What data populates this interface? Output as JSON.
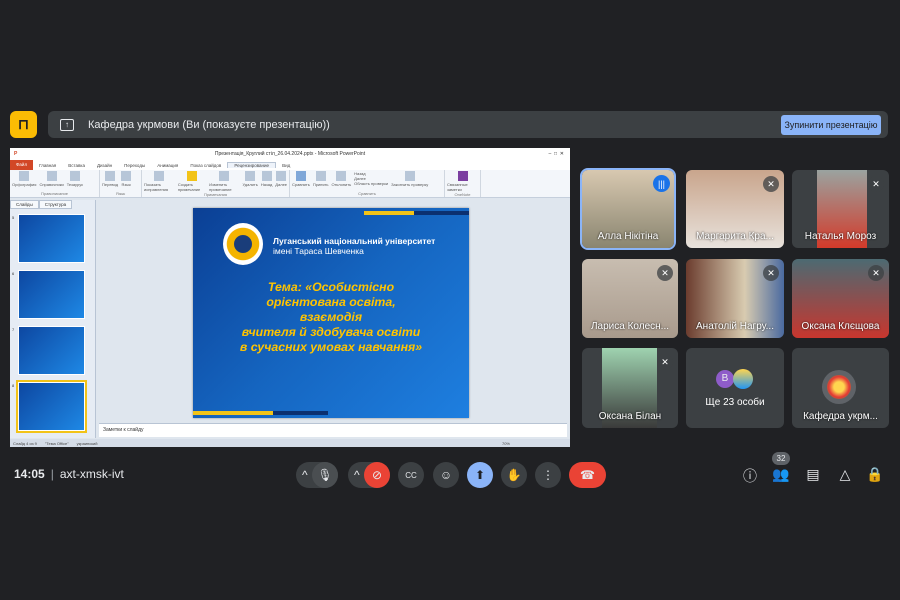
{
  "banner": {
    "text": "Кафедра укрмови (Ви (показуєте презентацію))",
    "stop_button": "Зупинити презентацію"
  },
  "ppt": {
    "window_title": "Презентація_Круглий стіл_26.04.2024.pptx - Microsoft PowerPoint",
    "tabs": [
      "Файл",
      "Главная",
      "Вставка",
      "Дизайн",
      "Переходы",
      "Анимация",
      "Показ слайдов",
      "Рецензирование",
      "Вид"
    ],
    "active_tab": "Рецензирование",
    "ribbon_groups": [
      {
        "label": "Правописание",
        "items": [
          "Орфография",
          "Справочники",
          "Тезаурус"
        ]
      },
      {
        "label": "Язык",
        "items": [
          "Перевод",
          "Язык"
        ]
      },
      {
        "label": "Примечания",
        "items": [
          "Показать исправления",
          "Создать примечание",
          "Изменить примечание",
          "Удалить",
          "Назад",
          "Далее"
        ]
      },
      {
        "label": "Сравнить",
        "items": [
          "Сравнить",
          "Принять",
          "Отклонить",
          "Назад",
          "Далее",
          "Область проверки",
          "Закончить проверку"
        ]
      },
      {
        "label": "OneNote",
        "items": [
          "Связанные заметки"
        ]
      }
    ],
    "pane_tabs": [
      "Слайды",
      "Структура"
    ],
    "thumbnails": [
      {
        "num": "5"
      },
      {
        "num": "6"
      },
      {
        "num": "7"
      },
      {
        "num": "8"
      }
    ],
    "slide": {
      "university_line1": "Луганський національний університет",
      "university_line2": "імені Тараса Шевченка",
      "theme_lines": [
        "Тема: «Особистісно",
        "орієнтована освіта,",
        "взаємодія",
        "вчителя й здобувача освіти",
        "в сучасних умовах навчання»"
      ]
    },
    "notes_placeholder": "Заметки к слайду",
    "status": {
      "slide": "Слайд 4 из 9",
      "theme": "\"Тема Office\"",
      "language": "украинский",
      "zoom": "70%"
    }
  },
  "participants": [
    {
      "name": "Алла Нікітіна",
      "speaking": true,
      "bg": "#8a8570"
    },
    {
      "name": "Маргарита Кра...",
      "bg": "#b59a86"
    },
    {
      "name": "Наталья Мороз",
      "bg": "#8f5c4d"
    },
    {
      "name": "Лариса Колесн...",
      "bg": "#a89a8c"
    },
    {
      "name": "Анатолій Нагру...",
      "bg": "#8c7a62"
    },
    {
      "name": "Оксана Клєщова",
      "bg": "#9a4b44"
    },
    {
      "name": "Оксана Білан",
      "bg": "#5d7a68"
    }
  ],
  "more": {
    "avatar_letter": "В",
    "label": "Ще 23 особи"
  },
  "self_tile": {
    "name": "Кафедра укрм..."
  },
  "bottom": {
    "time": "14:05",
    "meeting_code": "axt-xmsk-ivt",
    "participants_count": "32"
  }
}
